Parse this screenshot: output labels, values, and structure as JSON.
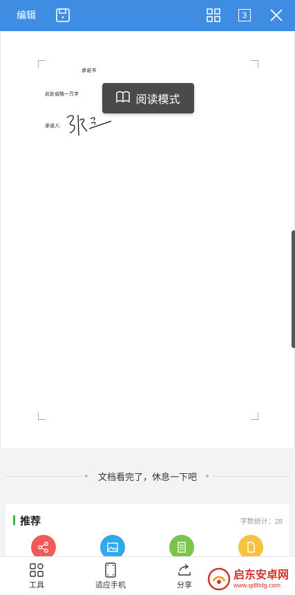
{
  "topbar": {
    "edit_label": "编辑",
    "page_count": "3"
  },
  "document": {
    "title": "承诺书",
    "body": "此处省略一万字",
    "sign_label": "承诺人:",
    "signature_text": "张三"
  },
  "toast": {
    "label": "阅读模式"
  },
  "end_message": "文档看完了，休息一下吧",
  "recommend": {
    "title": "推荐",
    "word_count": "字数统计：28"
  },
  "toolbar": {
    "tools_label": "工具",
    "fit_label": "适应手机",
    "share_label": "分享"
  },
  "watermark": {
    "name": "启东安卓网",
    "url": "www.qdlttdg.com"
  },
  "colors": {
    "accent": "#3f8de3",
    "red": "#f05a5a",
    "blue": "#2fa9e9",
    "green": "#7bc44a",
    "yellow": "#f7c23d"
  }
}
